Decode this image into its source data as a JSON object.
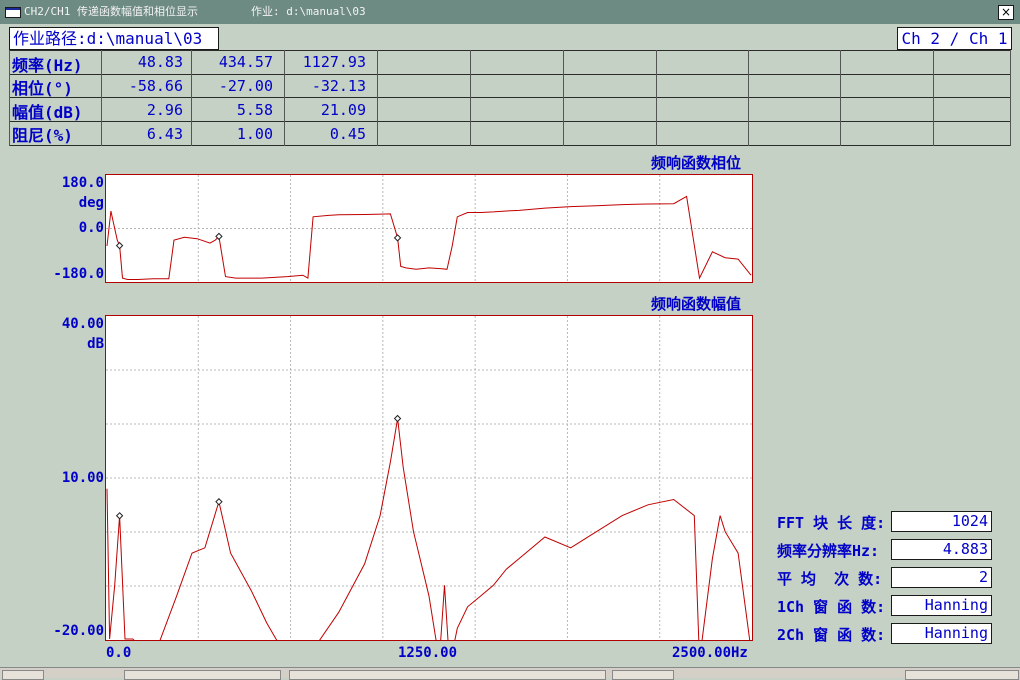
{
  "window": {
    "title": "CH2/CH1 传递函数幅值和相位显示        作业: d:\\manual\\03",
    "close_symbol": "×"
  },
  "header": {
    "path": "作业路径:d:\\manual\\03",
    "channel": "Ch 2 / Ch 1"
  },
  "modal_table": {
    "rows": [
      {
        "label": "频率(Hz)",
        "values": [
          "48.83",
          "434.57",
          "1127.93"
        ]
      },
      {
        "label": "相位(°)",
        "values": [
          "-58.66",
          "-27.00",
          "-32.13"
        ]
      },
      {
        "label": "幅值(dB)",
        "values": [
          "2.96",
          "5.58",
          "21.09"
        ]
      },
      {
        "label": "阻尼(%)",
        "values": [
          "6.43",
          "1.00",
          "0.45"
        ]
      }
    ]
  },
  "phase_plot": {
    "title": "频响函数相位",
    "y_top": "180.0",
    "y_unit": "deg",
    "y_mid": "0.0",
    "y_bottom": "-180.0"
  },
  "magnitude_plot": {
    "title": "频响函数幅值",
    "y_top": "40.00",
    "y_unit": "dB",
    "y_mid": "10.00",
    "y_bottom": "-20.00",
    "x_left": "0.0",
    "x_mid": "1250.00",
    "x_right": "2500.00Hz"
  },
  "params": [
    {
      "label": "FFT 块 长 度:",
      "value": "1024"
    },
    {
      "label": "频率分辨率Hz:",
      "value": "4.883"
    },
    {
      "label": "平 均  次 数:",
      "value": "2"
    },
    {
      "label": "1Ch 窗 函 数:",
      "value": "Hanning"
    },
    {
      "label": "2Ch 窗 函 数:",
      "value": "Hanning"
    }
  ],
  "colors": {
    "trace": "#c00000",
    "text": "#0000c8",
    "background": "#c5d1c5",
    "grid": "#b8b8b8"
  },
  "chart_data": [
    {
      "type": "line",
      "title": "频响函数相位",
      "ylabel": "deg",
      "xlim": [
        0,
        2500
      ],
      "ylim": [
        -180,
        180
      ],
      "grid": true,
      "markers_hz": [
        48.83,
        434.57,
        1127.93
      ],
      "series": [
        {
          "x": [
            0,
            15,
            25,
            40,
            48.83,
            60,
            80,
            120,
            180,
            240,
            260,
            300,
            350,
            400,
            420,
            434.57,
            460,
            500,
            600,
            700,
            760,
            780,
            800,
            860,
            900,
            1000,
            1100,
            1127.93,
            1140,
            1160,
            1200,
            1250,
            1300,
            1320,
            1340,
            1360,
            1400,
            1450,
            1500,
            1550,
            1600,
            1700,
            1800,
            1900,
            2000,
            2100,
            2200,
            2250,
            2300,
            2350,
            2400,
            2450,
            2500
          ],
          "y": [
            -60,
            60,
            20,
            -40,
            -58.66,
            -170,
            -175,
            -175,
            -172,
            -172,
            -40,
            -30,
            -35,
            -50,
            -40,
            -27,
            -165,
            -170,
            -170,
            -165,
            -160,
            -170,
            40,
            45,
            47,
            48,
            50,
            -32.13,
            -130,
            -135,
            -140,
            -135,
            -138,
            -140,
            -60,
            40,
            55,
            55,
            57,
            60,
            62,
            70,
            75,
            78,
            82,
            84,
            85,
            110,
            -170,
            -80,
            -100,
            -105,
            -160
          ]
        }
      ]
    },
    {
      "type": "line",
      "title": "频响函数幅值",
      "ylabel": "dB",
      "xlim": [
        0,
        2500
      ],
      "ylim": [
        -20,
        40
      ],
      "grid": true,
      "markers_hz": [
        48.83,
        434.57,
        1127.93
      ],
      "series": [
        {
          "x": [
            0,
            10,
            30,
            48.83,
            70,
            100,
            120,
            200,
            270,
            330,
            380,
            434.57,
            480,
            560,
            620,
            680,
            700,
            800,
            900,
            1000,
            1060,
            1100,
            1127.93,
            1150,
            1190,
            1220,
            1250,
            1290,
            1310,
            1330,
            1360,
            1400,
            1450,
            1500,
            1550,
            1600,
            1700,
            1800,
            1900,
            2000,
            2100,
            2200,
            2280,
            2300,
            2350,
            2380,
            2400,
            2450,
            2500
          ],
          "y": [
            8,
            -20,
            -10,
            2.96,
            -20,
            -20,
            -21,
            -21,
            -12,
            -4,
            -3,
            5.58,
            -4,
            -11,
            -17,
            -22,
            -21,
            -22,
            -15,
            -6,
            3,
            13,
            21.09,
            12,
            0,
            -6,
            -12,
            -24,
            -10,
            -25,
            -18,
            -14,
            -12,
            -10,
            -7,
            -5,
            -1,
            -3,
            0,
            3,
            5,
            6,
            3,
            -24,
            -5,
            3,
            0,
            -4,
            -22
          ]
        }
      ]
    }
  ]
}
